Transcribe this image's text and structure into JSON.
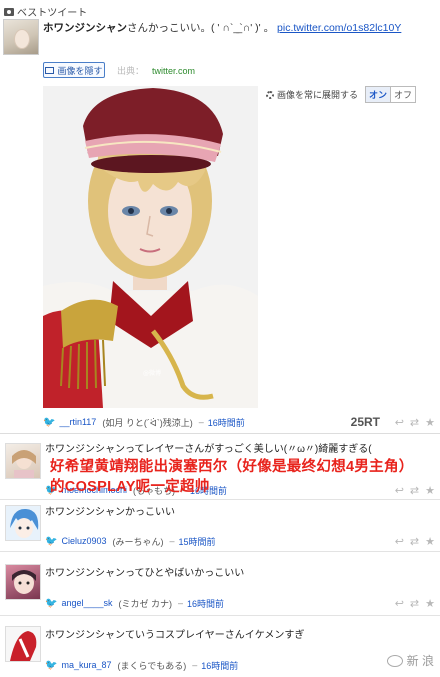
{
  "header": {
    "title": "ベストツイート"
  },
  "best_tweet": {
    "user": "ホワンジンシャン",
    "text": "さんかっこいい。( ' ∩`_̲`∩' )' 。",
    "link": "pic.twitter.com/o1s82lc10Y",
    "show_image_label": "画像を隠す",
    "source_label": "出典：",
    "source_value": "twitter.com",
    "setting_label": "画像を常に展開する",
    "toggle_on": "オン",
    "toggle_off": "オフ",
    "meta_user": "__rtin117",
    "meta_nick": "(如月 りと(´ᐛ`)残涼上)",
    "meta_time": "16時間前",
    "rt_count": "25RT"
  },
  "tweets": [
    {
      "text": "ホワンジンシャンってレイヤーさんがすっごく美しい(〃ω〃)綺麗すぎる(",
      "user": "moemochimochi",
      "nick": "(もゃもち)",
      "time": "16時間前"
    },
    {
      "text": "ホワンジンシャンかっこいい",
      "user": "Cieluz0903",
      "nick": "(みーちゃん)",
      "time": "15時間前"
    },
    {
      "text": "ホワンジンシャンってひとやばいかっこいい",
      "user": "angel____sk",
      "nick": "(ミカゼ カナ)",
      "time": "16時間前"
    },
    {
      "text": "ホワンジンシャンていうコスプレイヤーさんイケメンすぎ",
      "user": "ma_kura_87",
      "nick": "(まくらでもある)",
      "time": "16時間前"
    }
  ],
  "overlay": {
    "line1": "好希望黄靖翔能出演塞西尔（好像是最终幻想4男主角）",
    "line2": "的COSPLAY呢一定超帅"
  },
  "watermark": {
    "text": "新 浪"
  },
  "colors": {
    "link": "#1a56c6",
    "overlay_red": "#e8231c",
    "bird": "#2fa9e2"
  }
}
